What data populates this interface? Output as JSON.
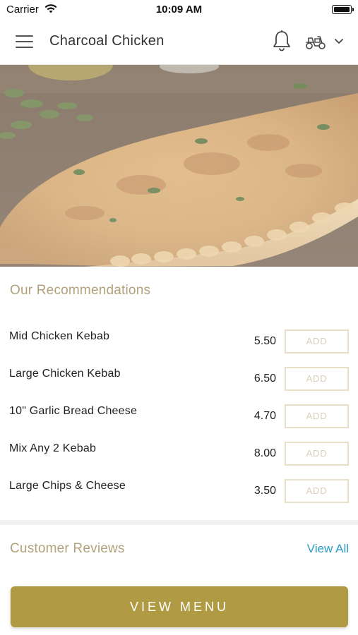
{
  "status_bar": {
    "carrier": "Carrier",
    "time": "10:09 AM"
  },
  "header": {
    "title": "Charcoal Chicken",
    "icons": [
      "menu-icon",
      "bell-icon",
      "scooter-icon",
      "chevron-down-icon"
    ]
  },
  "recommendations": {
    "title": "Our Recommendations",
    "items": [
      {
        "name": "Mid Chicken Kebab",
        "price": "5.50",
        "action": "ADD"
      },
      {
        "name": "Large Chicken Kebab",
        "price": "6.50",
        "action": "ADD"
      },
      {
        "name": "10\" Garlic Bread Cheese",
        "price": "4.70",
        "action": "ADD"
      },
      {
        "name": "Mix Any 2 Kebab",
        "price": "8.00",
        "action": "ADD"
      },
      {
        "name": "Large Chips & Cheese",
        "price": "3.50",
        "action": "ADD"
      }
    ]
  },
  "reviews": {
    "title": "Customer Reviews",
    "view_all": "View All"
  },
  "footer": {
    "view_menu_label": "VIEW MENU"
  },
  "colors": {
    "brand_gold": "#b09a44",
    "section_title": "#b2a17a",
    "link_blue": "#2a9bc4",
    "add_border": "#e8e0c6"
  }
}
